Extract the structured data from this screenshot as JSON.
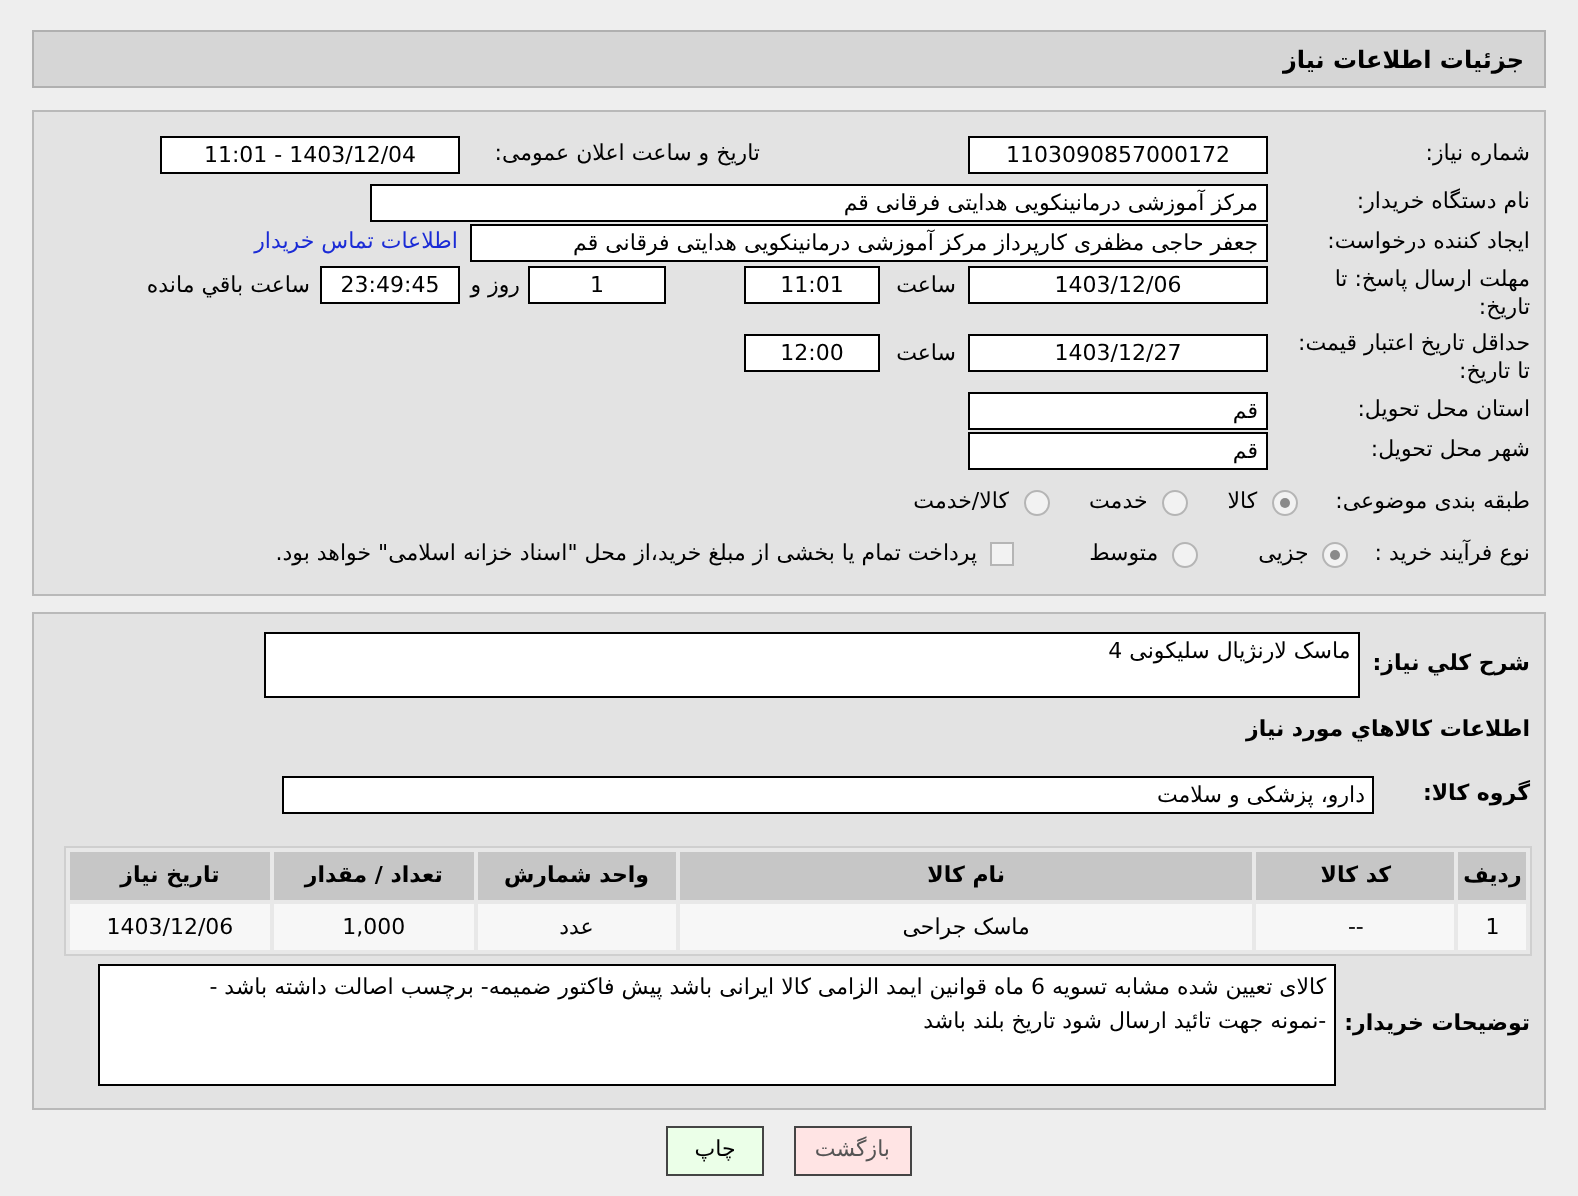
{
  "header": {
    "title": "جزئیات اطلاعات نیاز"
  },
  "details": {
    "need_number": {
      "label": "شماره نیاز:",
      "value": "1103090857000172"
    },
    "announce": {
      "label": "تاریخ و ساعت اعلان عمومی:",
      "value": "1403/12/04 - 11:01"
    },
    "buyer_org": {
      "label": "نام دستگاه خریدار:",
      "value": "مرکز آموزشی درمانینکویی هدایتی فرقانی قم"
    },
    "requester": {
      "label": "ایجاد کننده درخواست:",
      "value": "جعفر حاجی مظفری کارپرداز مرکز آموزشی درمانینکویی هدایتی فرقانی قم",
      "link": "اطلاعات تماس خریدار"
    },
    "reply_deadline": {
      "label": "مهلت ارسال پاسخ: تا تاریخ:",
      "date": "1403/12/06",
      "time_label": "ساعت",
      "time": "11:01",
      "days": "1",
      "days_label": "روز و",
      "remaining": "23:49:45",
      "remaining_label": "ساعت باقي مانده"
    },
    "price_validity": {
      "label": "حداقل تاریخ اعتبار قیمت: تا تاریخ:",
      "date": "1403/12/27",
      "time_label": "ساعت",
      "time": "12:00"
    },
    "province": {
      "label": "استان محل تحویل:",
      "value": "قم"
    },
    "city": {
      "label": "شهر محل تحویل:",
      "value": "قم"
    },
    "category": {
      "label": "طبقه بندی موضوعی:",
      "options": [
        {
          "label": "کالا",
          "selected": true
        },
        {
          "label": "خدمت",
          "selected": false
        },
        {
          "label": "کالا/خدمت",
          "selected": false
        }
      ]
    },
    "purchase_type": {
      "label": "نوع فرآیند خرید :",
      "options": [
        {
          "label": "جزیی",
          "selected": true
        },
        {
          "label": "متوسط",
          "selected": false
        }
      ],
      "payment_note": {
        "label": "پرداخت تمام یا بخشی از مبلغ خرید،از محل \"اسناد خزانه اسلامی\" خواهد بود.",
        "checked": false
      }
    }
  },
  "summary": {
    "label": "شرح کلي نياز:",
    "value": "ماسک لارنژیال سلیکونی 4"
  },
  "goods_title": "اطلاعات كالاهاي مورد نياز",
  "goods_group": {
    "label": "گروه کالا:",
    "value": "دارو، پزشکی و سلامت"
  },
  "table": {
    "columns": [
      "ردیف",
      "کد کالا",
      "نام کالا",
      "واحد شمارش",
      "تعداد / مقدار",
      "تاریخ نیاز"
    ],
    "rows": [
      [
        "1",
        "--",
        "ماسک جراحی",
        "عدد",
        "1,000",
        "1403/12/06"
      ]
    ]
  },
  "buyer_notes": {
    "label": "توضیحات خریدار:",
    "value": "کالای تعیین شده مشابه تسویه 6 ماه قوانین ایمد الزامی کالا ایرانی باشد پیش فاکتور ضمیمه- برچسب اصالت داشته باشد -\n-نمونه جهت تائید ارسال شود تاریخ بلند باشد"
  },
  "buttons": [
    {
      "label": "بازگشت",
      "kind": "back"
    },
    {
      "label": "چاپ",
      "kind": "print"
    }
  ]
}
